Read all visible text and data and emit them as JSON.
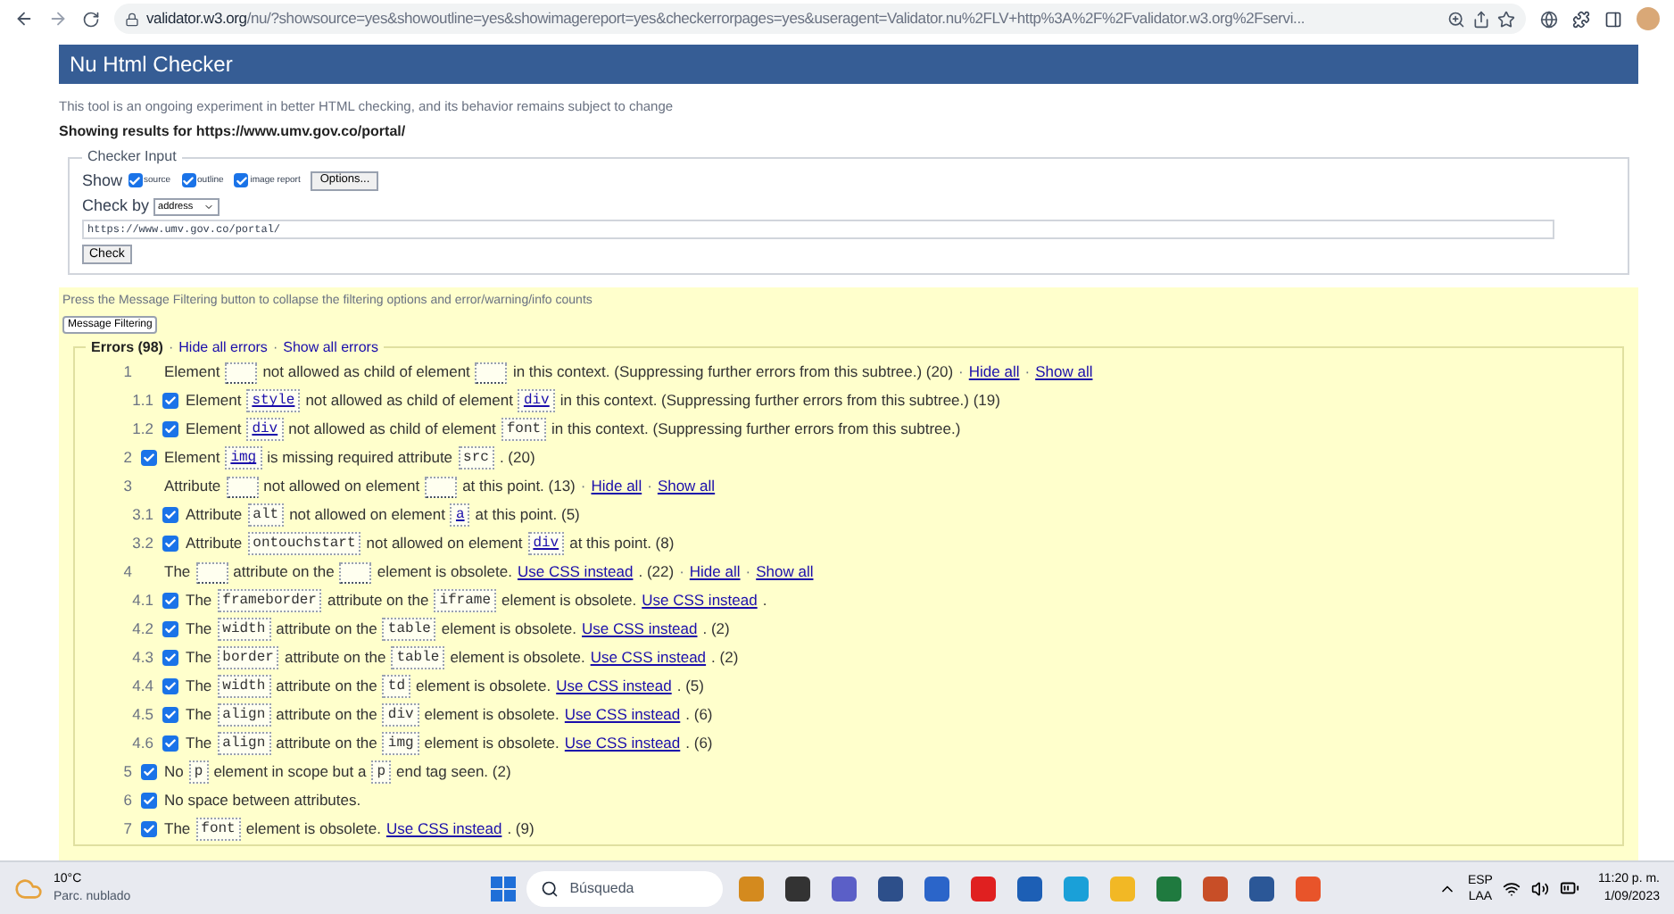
{
  "browser": {
    "url_host": "validator.w3.org",
    "url_path": "/nu/?showsource=yes&showoutline=yes&showimagereport=yes&checkerrorpages=yes&useragent=Validator.nu%2FLV+http%3A%2F%2Fvalidator.w3.org%2Fservi..."
  },
  "header": {
    "title": "Nu Html Checker"
  },
  "intro": "This tool is an ongoing experiment in better HTML checking, and its behavior remains subject to change",
  "results_for": "Showing results for https://www.umv.gov.co/portal/",
  "checker_input": {
    "legend": "Checker Input",
    "show_label": "Show",
    "options": [
      {
        "label": "source",
        "checked": true
      },
      {
        "label": "outline",
        "checked": true
      },
      {
        "label": "image report",
        "checked": true
      }
    ],
    "options_button": "Options...",
    "check_by_label": "Check by",
    "check_by_value": "address",
    "address": "https://www.umv.gov.co/portal/",
    "check_button": "Check"
  },
  "filter_note": "Press the Message Filtering button to collapse the filtering options and error/warning/info counts",
  "filter_button": "Message Filtering",
  "errors": {
    "title": "Errors (98)",
    "separator": "·",
    "links": [
      "Hide all errors",
      "Show all errors"
    ],
    "messages": [
      {
        "number": "1",
        "kind": "group",
        "parts": [
          {
            "kind": "text",
            "text": "Element"
          },
          {
            "kind": "blank"
          },
          {
            "kind": "text",
            "text": "not allowed as child of element"
          },
          {
            "kind": "blank"
          },
          {
            "kind": "text",
            "text": "in this context. (Suppressing further errors from this subtree.) (20)"
          },
          {
            "kind": "sep",
            "text": "·"
          },
          {
            "kind": "link",
            "text": "Hide all"
          },
          {
            "kind": "sep",
            "text": "·"
          },
          {
            "kind": "link",
            "text": "Show all"
          }
        ],
        "children": [
          {
            "number": "1.1",
            "kind": "message",
            "checked": true,
            "parts": [
              {
                "kind": "text",
                "text": "Element"
              },
              {
                "kind": "code_link",
                "text": "style"
              },
              {
                "kind": "text",
                "text": "not allowed as child of element"
              },
              {
                "kind": "code_link",
                "text": "div"
              },
              {
                "kind": "text",
                "text": "in this context. (Suppressing further errors from this subtree.) (19)"
              }
            ]
          },
          {
            "number": "1.2",
            "kind": "message",
            "checked": true,
            "parts": [
              {
                "kind": "text",
                "text": "Element"
              },
              {
                "kind": "code_link",
                "text": "div"
              },
              {
                "kind": "text",
                "text": "not allowed as child of element"
              },
              {
                "kind": "code",
                "text": "font"
              },
              {
                "kind": "text",
                "text": "in this context. (Suppressing further errors from this subtree.)"
              }
            ]
          }
        ]
      },
      {
        "number": "2",
        "kind": "message",
        "checked": true,
        "parts": [
          {
            "kind": "text",
            "text": "Element"
          },
          {
            "kind": "code_link",
            "text": "img"
          },
          {
            "kind": "text",
            "text": "is missing required attribute"
          },
          {
            "kind": "code",
            "text": "src"
          },
          {
            "kind": "text",
            "text": ". (20)"
          }
        ]
      },
      {
        "number": "3",
        "kind": "group",
        "parts": [
          {
            "kind": "text",
            "text": "Attribute"
          },
          {
            "kind": "blank"
          },
          {
            "kind": "text",
            "text": "not allowed on element"
          },
          {
            "kind": "blank"
          },
          {
            "kind": "text",
            "text": "at this point. (13)"
          },
          {
            "kind": "sep",
            "text": "·"
          },
          {
            "kind": "link",
            "text": "Hide all"
          },
          {
            "kind": "sep",
            "text": "·"
          },
          {
            "kind": "link",
            "text": "Show all"
          }
        ],
        "children": [
          {
            "number": "3.1",
            "kind": "message",
            "checked": true,
            "parts": [
              {
                "kind": "text",
                "text": "Attribute"
              },
              {
                "kind": "code",
                "text": "alt"
              },
              {
                "kind": "text",
                "text": "not allowed on element"
              },
              {
                "kind": "code_link",
                "text": "a"
              },
              {
                "kind": "text",
                "text": "at this point. (5)"
              }
            ]
          },
          {
            "number": "3.2",
            "kind": "message",
            "checked": true,
            "parts": [
              {
                "kind": "text",
                "text": "Attribute"
              },
              {
                "kind": "code",
                "text": "ontouchstart"
              },
              {
                "kind": "text",
                "text": "not allowed on element"
              },
              {
                "kind": "code_link",
                "text": "div"
              },
              {
                "kind": "text",
                "text": "at this point. (8)"
              }
            ]
          }
        ]
      },
      {
        "number": "4",
        "kind": "group",
        "parts": [
          {
            "kind": "text",
            "text": "The"
          },
          {
            "kind": "blank"
          },
          {
            "kind": "text",
            "text": "attribute on the"
          },
          {
            "kind": "blank"
          },
          {
            "kind": "text",
            "text": "element is obsolete."
          },
          {
            "kind": "link",
            "text": "Use CSS instead"
          },
          {
            "kind": "text",
            "text": ". (22)"
          },
          {
            "kind": "sep",
            "text": "·"
          },
          {
            "kind": "link",
            "text": "Hide all"
          },
          {
            "kind": "sep",
            "text": "·"
          },
          {
            "kind": "link",
            "text": "Show all"
          }
        ],
        "children": [
          {
            "number": "4.1",
            "kind": "message",
            "checked": true,
            "parts": [
              {
                "kind": "text",
                "text": "The"
              },
              {
                "kind": "code",
                "text": "frameborder"
              },
              {
                "kind": "text",
                "text": "attribute on the"
              },
              {
                "kind": "code",
                "text": "iframe"
              },
              {
                "kind": "text",
                "text": "element is obsolete."
              },
              {
                "kind": "link",
                "text": "Use CSS instead"
              },
              {
                "kind": "text",
                "text": "."
              }
            ]
          },
          {
            "number": "4.2",
            "kind": "message",
            "checked": true,
            "parts": [
              {
                "kind": "text",
                "text": "The"
              },
              {
                "kind": "code",
                "text": "width"
              },
              {
                "kind": "text",
                "text": "attribute on the"
              },
              {
                "kind": "code",
                "text": "table"
              },
              {
                "kind": "text",
                "text": "element is obsolete."
              },
              {
                "kind": "link",
                "text": "Use CSS instead"
              },
              {
                "kind": "text",
                "text": ". (2)"
              }
            ]
          },
          {
            "number": "4.3",
            "kind": "message",
            "checked": true,
            "parts": [
              {
                "kind": "text",
                "text": "The"
              },
              {
                "kind": "code",
                "text": "border"
              },
              {
                "kind": "text",
                "text": "attribute on the"
              },
              {
                "kind": "code",
                "text": "table"
              },
              {
                "kind": "text",
                "text": "element is obsolete."
              },
              {
                "kind": "link",
                "text": "Use CSS instead"
              },
              {
                "kind": "text",
                "text": ". (2)"
              }
            ]
          },
          {
            "number": "4.4",
            "kind": "message",
            "checked": true,
            "parts": [
              {
                "kind": "text",
                "text": "The"
              },
              {
                "kind": "code",
                "text": "width"
              },
              {
                "kind": "text",
                "text": "attribute on the"
              },
              {
                "kind": "code",
                "text": "td"
              },
              {
                "kind": "text",
                "text": "element is obsolete."
              },
              {
                "kind": "link",
                "text": "Use CSS instead"
              },
              {
                "kind": "text",
                "text": ". (5)"
              }
            ]
          },
          {
            "number": "4.5",
            "kind": "message",
            "checked": true,
            "parts": [
              {
                "kind": "text",
                "text": "The"
              },
              {
                "kind": "code",
                "text": "align"
              },
              {
                "kind": "text",
                "text": "attribute on the"
              },
              {
                "kind": "code",
                "text": "div"
              },
              {
                "kind": "text",
                "text": "element is obsolete."
              },
              {
                "kind": "link",
                "text": "Use CSS instead"
              },
              {
                "kind": "text",
                "text": ". (6)"
              }
            ]
          },
          {
            "number": "4.6",
            "kind": "message",
            "checked": true,
            "parts": [
              {
                "kind": "text",
                "text": "The"
              },
              {
                "kind": "code",
                "text": "align"
              },
              {
                "kind": "text",
                "text": "attribute on the"
              },
              {
                "kind": "code",
                "text": "img"
              },
              {
                "kind": "text",
                "text": "element is obsolete."
              },
              {
                "kind": "link",
                "text": "Use CSS instead"
              },
              {
                "kind": "text",
                "text": ". (6)"
              }
            ]
          }
        ]
      },
      {
        "number": "5",
        "kind": "message",
        "checked": true,
        "parts": [
          {
            "kind": "text",
            "text": "No"
          },
          {
            "kind": "code",
            "text": "p"
          },
          {
            "kind": "text",
            "text": "element in scope but a"
          },
          {
            "kind": "code",
            "text": "p"
          },
          {
            "kind": "text",
            "text": "end tag seen. (2)"
          }
        ]
      },
      {
        "number": "6",
        "kind": "message",
        "checked": true,
        "parts": [
          {
            "kind": "text",
            "text": "No space between attributes."
          }
        ]
      },
      {
        "number": "7",
        "kind": "message",
        "checked": true,
        "parts": [
          {
            "kind": "text",
            "text": "The"
          },
          {
            "kind": "code",
            "text": "font"
          },
          {
            "kind": "text",
            "text": "element is obsolete."
          },
          {
            "kind": "link",
            "text": "Use CSS instead"
          },
          {
            "kind": "text",
            "text": ". (9)"
          }
        ]
      }
    ]
  },
  "taskbar": {
    "temperature": "10°C",
    "weather": "Parc. nublado",
    "search": "Búsqueda",
    "language": "ESP",
    "layout": "LAA",
    "time": "11:20 p. m.",
    "date": "1/09/2023"
  }
}
